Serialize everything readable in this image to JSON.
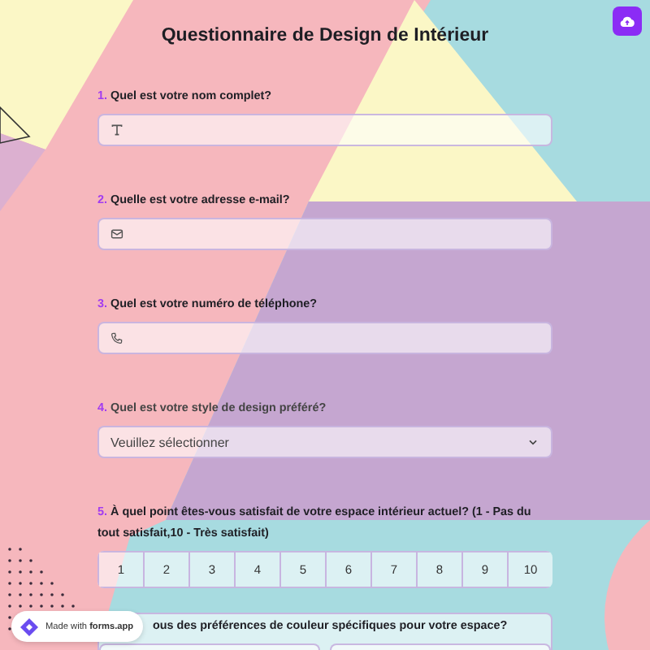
{
  "title": "Questionnaire de Design de Intérieur",
  "questions": [
    {
      "kind": "text",
      "number": "1.",
      "label": "Quel est votre nom complet?"
    },
    {
      "kind": "email",
      "number": "2.",
      "label": "Quelle est votre adresse e-mail?"
    },
    {
      "kind": "phone",
      "number": "3.",
      "label": "Quel est votre numéro de téléphone?"
    },
    {
      "kind": "select",
      "number": "4.",
      "label": "Quel est votre style de design préféré?",
      "placeholder": "Veuillez sélectionner"
    },
    {
      "kind": "scale",
      "number": "5.",
      "label": "À quel point êtes-vous satisfait de votre espace intérieur actuel? (1 - Pas du tout satisfait,10 - Très satisfait)",
      "options": [
        "1",
        "2",
        "3",
        "4",
        "5",
        "6",
        "7",
        "8",
        "9",
        "10"
      ]
    },
    {
      "kind": "choice",
      "label": "ous des préférences de couleur spécifiques pour votre espace?"
    }
  ],
  "badge": {
    "text": "Made with **forms.app**"
  }
}
